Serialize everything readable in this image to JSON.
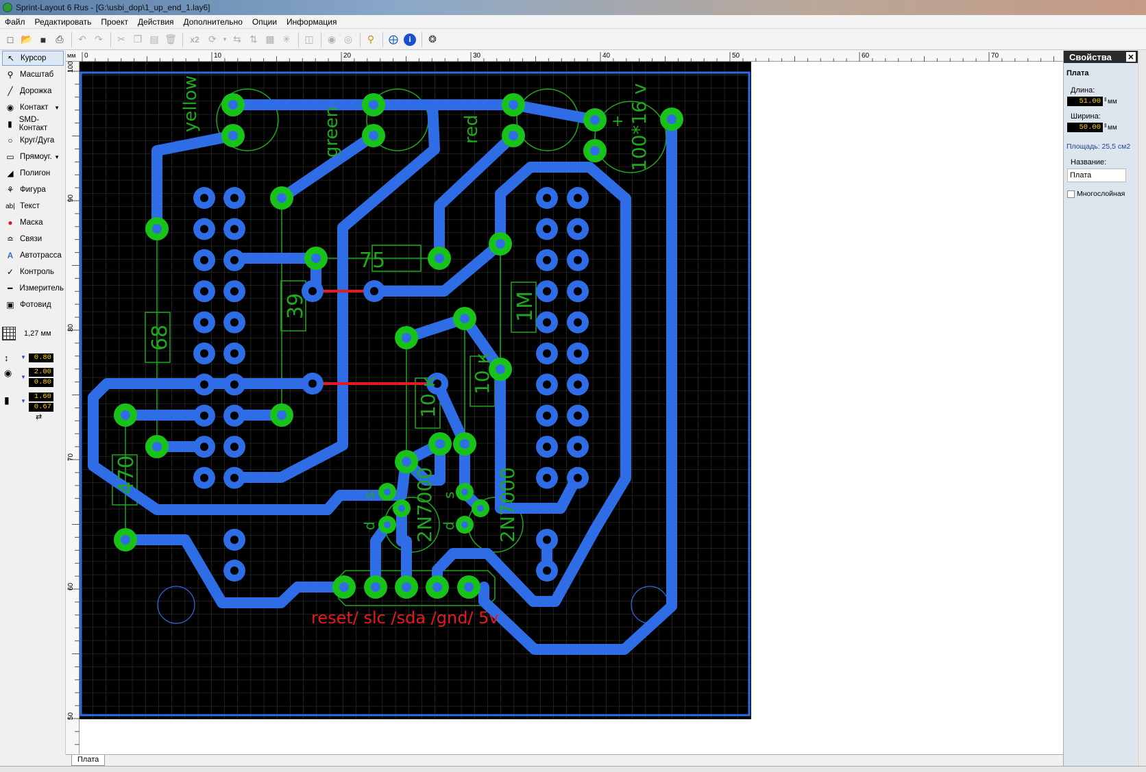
{
  "window": {
    "title": "Sprint-Layout 6 Rus - [G:\\usbi_dop\\1_up_end_1.lay6]"
  },
  "menu": [
    "Файл",
    "Редактировать",
    "Проект",
    "Действия",
    "Дополнительно",
    "Опции",
    "Информация"
  ],
  "toolbar": {
    "zoom_label": "x2"
  },
  "tools": [
    {
      "label": "Курсор",
      "icon": "cursor-icon"
    },
    {
      "label": "Масштаб",
      "icon": "zoom-icon"
    },
    {
      "label": "Дорожка",
      "icon": "track-icon"
    },
    {
      "label": "Контакт",
      "icon": "pad-icon"
    },
    {
      "label": "SMD-Контакт",
      "icon": "smd-pad-icon"
    },
    {
      "label": "Круг/Дуга",
      "icon": "circle-icon"
    },
    {
      "label": "Прямоуг.",
      "icon": "rectangle-icon"
    },
    {
      "label": "Полигон",
      "icon": "polygon-icon"
    },
    {
      "label": "Фигура",
      "icon": "shape-icon"
    },
    {
      "label": "Текст",
      "icon": "text-icon"
    },
    {
      "label": "Маска",
      "icon": "mask-icon"
    },
    {
      "label": "Связи",
      "icon": "connections-icon"
    },
    {
      "label": "Автотрасса",
      "icon": "autoroute-icon"
    },
    {
      "label": "Контроль",
      "icon": "check-icon"
    },
    {
      "label": "Измеритель",
      "icon": "measure-icon"
    },
    {
      "label": "Фотовид",
      "icon": "photoview-icon"
    }
  ],
  "grid": {
    "label": "1,27 мм"
  },
  "values": {
    "track_width": "0.80",
    "pad_outer": "2.00",
    "pad_inner": "0.80",
    "smd_w": "1.60",
    "smd_h": "0.67"
  },
  "ruler": {
    "unit": "мм",
    "top": [
      "0",
      "10",
      "20",
      "30",
      "40",
      "50",
      "60",
      "70"
    ],
    "left": [
      "100",
      "90",
      "80",
      "70",
      "60",
      "50"
    ]
  },
  "tab": {
    "label": "Плата"
  },
  "props": {
    "header": "Свойства",
    "section": "Плата",
    "length_label": "Длина:",
    "length": "51.00",
    "width_label": "Ширина:",
    "width": "50.00",
    "unit": "мм",
    "area": "Площадь: 25,5 см2",
    "name_label": "Название:",
    "name": "Плата",
    "multilayer": "Многослойная"
  },
  "board": {
    "labels": {
      "yellow": "yellow",
      "green": "green",
      "red": "red",
      "cap": "100*16 v",
      "plus": "+",
      "r75": "75",
      "r39": "39",
      "r68": "68",
      "r1m": "1M",
      "r10k_a": "10 к",
      "r10k_b": "10 к",
      "r470": "470",
      "q1": "2N7000",
      "q2": "2N7000",
      "s1": "s",
      "d1": "d",
      "s2": "s",
      "d2": "d",
      "connector": "reset/ slc /sda /gnd/ 5v"
    },
    "colors": {
      "background": "#000000",
      "grid": "#3a3a3a",
      "track": "#2e6de6",
      "pad_ring": "#19c219",
      "pad_hole": "#2e6de6",
      "silk": "#1fa81f",
      "bridge": "#e8191e",
      "connector_text": "#e8191e"
    }
  }
}
